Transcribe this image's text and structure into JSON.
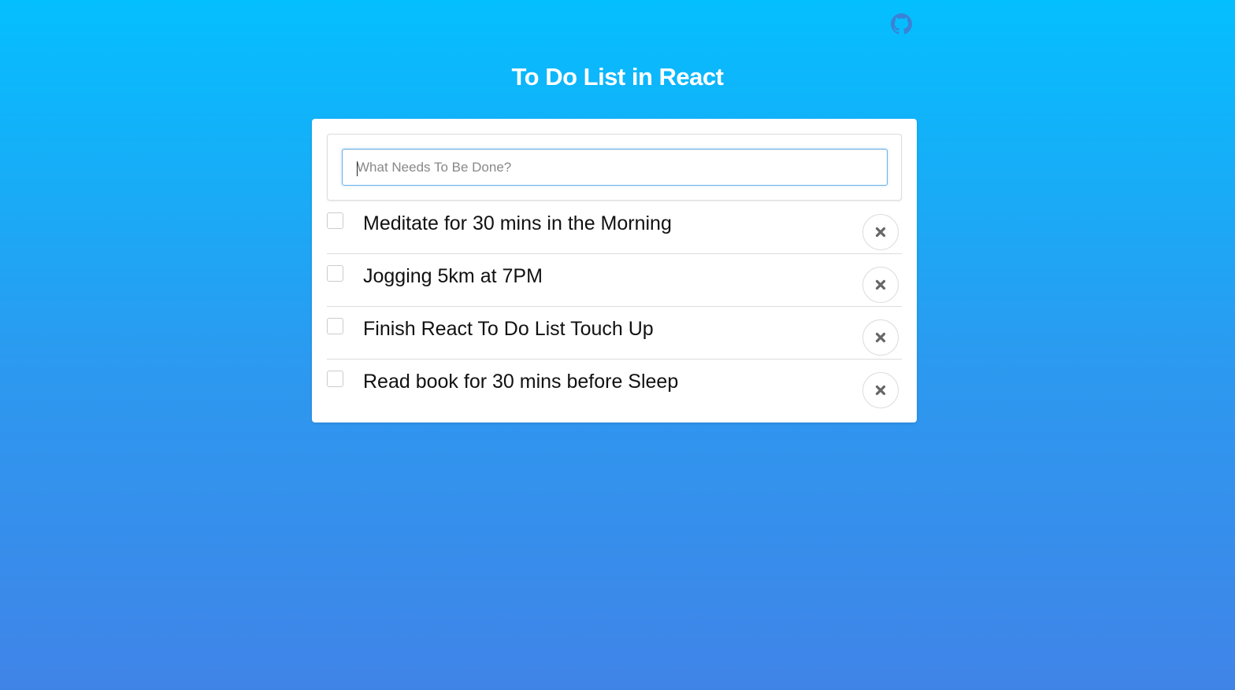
{
  "header": {
    "github_icon": "github-icon",
    "title": "To Do List in React"
  },
  "input": {
    "placeholder": "What Needs To Be Done?",
    "value": ""
  },
  "todos": [
    {
      "text": "Meditate for 30 mins in the Morning",
      "checked": false,
      "delete_icon": "close-icon"
    },
    {
      "text": "Jogging 5km at 7PM",
      "checked": false,
      "delete_icon": "close-icon"
    },
    {
      "text": "Finish React To Do List Touch Up",
      "checked": false,
      "delete_icon": "close-icon"
    },
    {
      "text": "Read book for 30 mins before Sleep",
      "checked": false,
      "delete_icon": "close-icon"
    }
  ],
  "colors": {
    "background_top": "#04bffe",
    "background_bottom": "#4084e8",
    "card": "#ffffff",
    "input_focus_border": "#66afe9",
    "delete_icon": "#666666",
    "github_icon": "#3a82d6"
  }
}
